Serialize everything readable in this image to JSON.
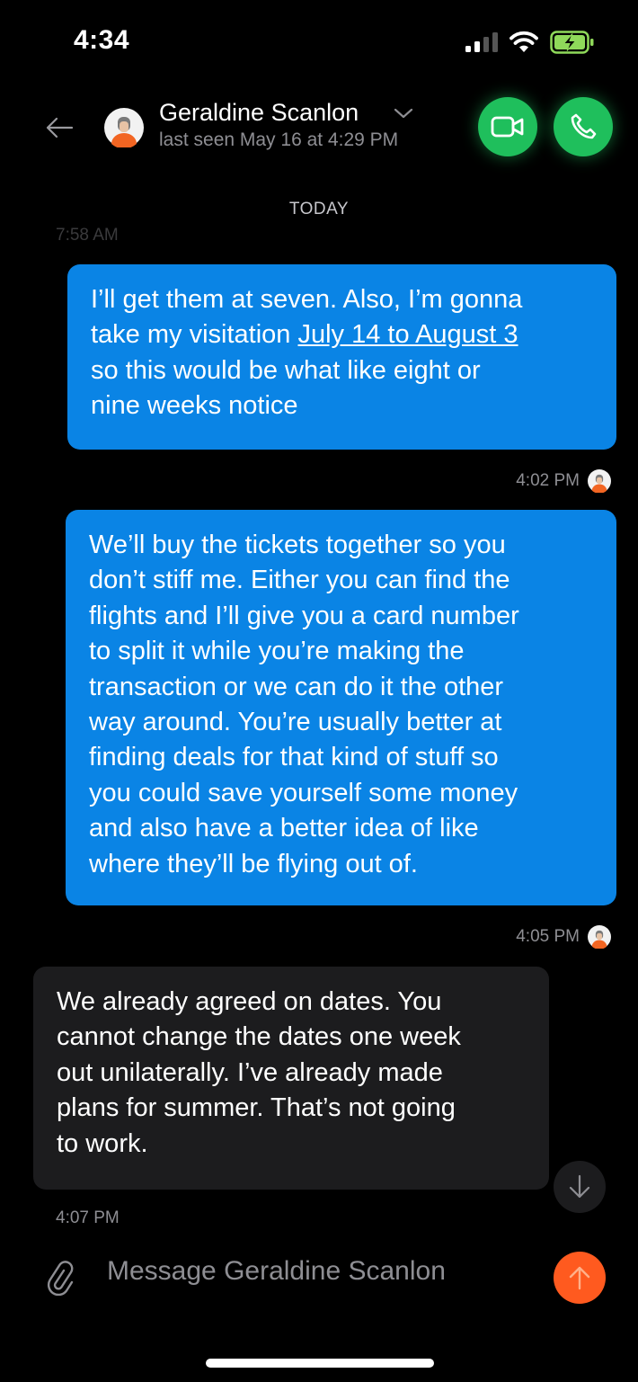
{
  "status_bar": {
    "time": "4:34",
    "icons": [
      "cellular-signal-icon",
      "wifi-icon",
      "battery-charging-icon"
    ]
  },
  "header": {
    "contact_name": "Geraldine Scanlon",
    "last_seen": "last seen May 16 at 4:29 PM",
    "icons": [
      "back-arrow-icon",
      "contact-avatar",
      "chevron-down-icon",
      "video-camera-icon",
      "phone-icon"
    ]
  },
  "conversation": {
    "date_divider": "TODAY",
    "faded_timestamp": "7:58 AM",
    "messages": [
      {
        "direction": "outgoing",
        "lines": [
          "I’ll get them at seven. Also, I’m gonna",
          "take my visitation ",
          "July 14 to August 3",
          "so this would be what like eight or",
          "nine weeks notice"
        ],
        "time": "4:02 PM"
      },
      {
        "direction": "outgoing",
        "lines": [
          "We’ll buy the tickets together so you",
          "don’t stiff me. Either you can find the",
          "flights and I’ll give you a card number",
          "to split it while you’re making the",
          "transaction or we can do it the other",
          "way around. You’re usually better at",
          "finding deals for that kind of stuff so",
          "you could save yourself some money",
          "and also have a better idea of like",
          "where they’ll be flying out of."
        ],
        "time": "4:05 PM"
      },
      {
        "direction": "incoming",
        "lines": [
          "We already agreed on dates. You",
          "cannot change the dates one week",
          "out unilaterally. I’ve already made",
          "plans for summer. That’s not going",
          "to work."
        ],
        "time": "4:07 PM"
      }
    ]
  },
  "composer": {
    "placeholder": "Message Geraldine Scanlon",
    "value": "",
    "icons": [
      "paperclip-icon",
      "arrow-down-icon",
      "send-arrow-icon"
    ]
  },
  "colors": {
    "background": "#000000",
    "outgoing_bubble": "#0a84e5",
    "incoming_bubble": "#1c1c1e",
    "call_button": "#1fbf5c",
    "send_button": "#ff5a1f",
    "secondary_text": "#8e8e93"
  }
}
